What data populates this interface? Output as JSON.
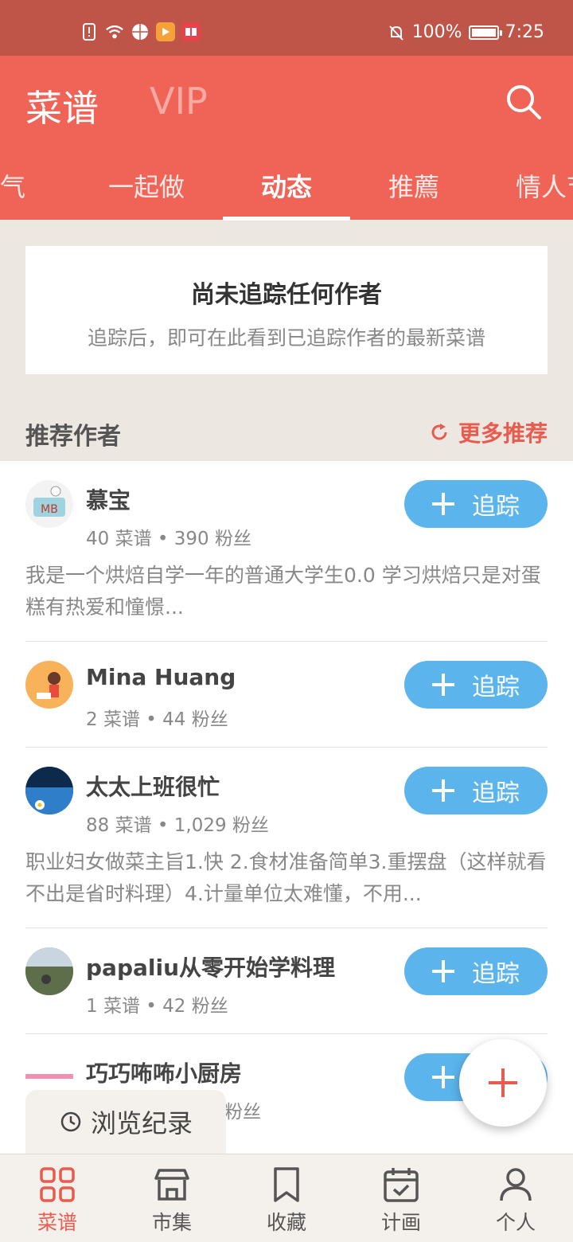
{
  "status_bar": {
    "battery": "100%",
    "time": "7:25"
  },
  "header": {
    "title": "菜谱",
    "vip": "VIP"
  },
  "tabs": [
    {
      "label": "人气"
    },
    {
      "label": "一起做"
    },
    {
      "label": "动态"
    },
    {
      "label": "推薦"
    },
    {
      "label": "情人节"
    }
  ],
  "empty_state": {
    "title": "尚未追踪任何作者",
    "description": "追踪后，即可在此看到已追踪作者的最新菜谱"
  },
  "recommend": {
    "label": "推荐作者",
    "more": "更多推荐"
  },
  "follow_label": "追踪",
  "authors": [
    {
      "name": "慕宝",
      "stats": "40 菜谱 • 390 粉丝",
      "bio": "我是一个烘焙自学一年的普通大学生0.0 学习烘焙只是对蛋糕有热爱和憧憬..."
    },
    {
      "name": "Mina Huang",
      "stats": "2 菜谱 • 44 粉丝",
      "bio": ""
    },
    {
      "name": "太太上班很忙",
      "stats": "88 菜谱 • 1,029 粉丝",
      "bio": "职业妇女做菜主旨1.快 2.食材准备简单3.重摆盘（这样就看不出是省时料理）4.计量单位太难懂，不用..."
    },
    {
      "name": "papaliu从零开始学料理",
      "stats": "1 菜谱 • 42 粉丝",
      "bio": ""
    },
    {
      "name": "巧巧咘咘小厨房",
      "stats": "粉丝",
      "bio": ""
    }
  ],
  "history_chip": "浏览纪录",
  "bottom_nav": [
    {
      "label": "菜谱",
      "icon": "grid-icon",
      "active": true
    },
    {
      "label": "市集",
      "icon": "store-icon",
      "active": false
    },
    {
      "label": "收藏",
      "icon": "bookmark-icon",
      "active": false
    },
    {
      "label": "计画",
      "icon": "calendar-check-icon",
      "active": false
    },
    {
      "label": "个人",
      "icon": "person-icon",
      "active": false
    }
  ],
  "colors": {
    "brand": "#f06458",
    "follow": "#5bb4ec",
    "accent_text": "#e85b4f"
  }
}
